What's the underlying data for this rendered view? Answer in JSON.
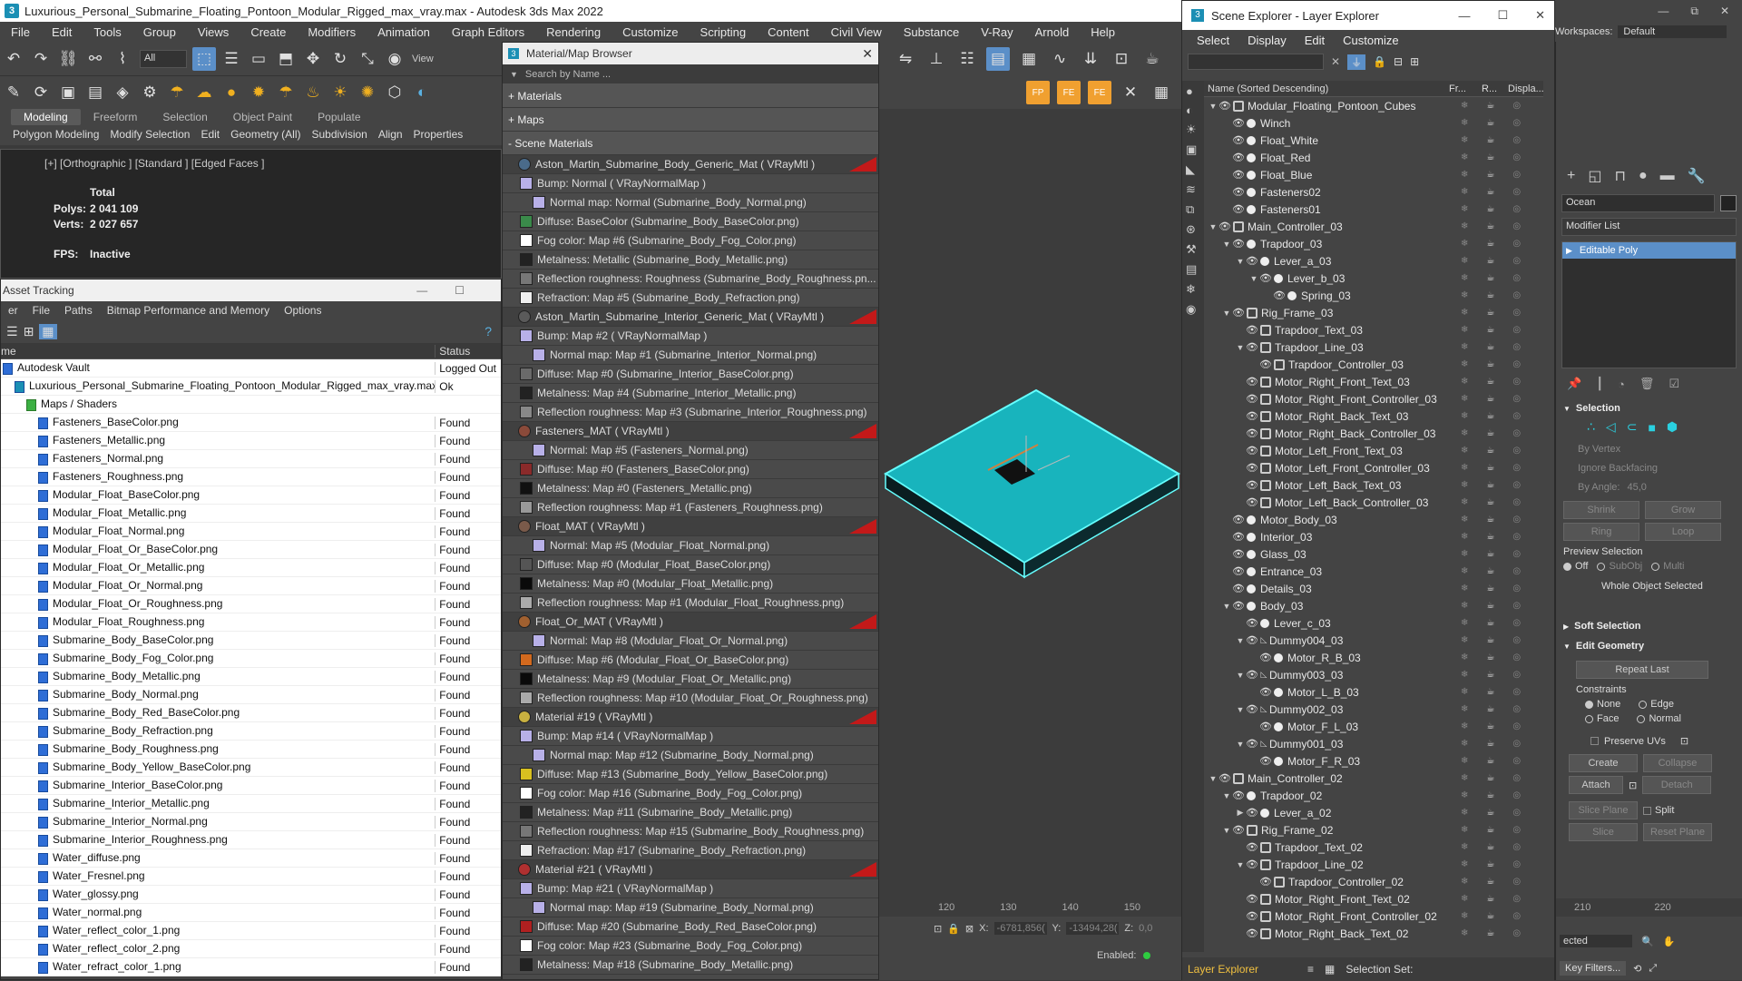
{
  "window": {
    "title": "Luxurious_Personal_Submarine_Floating_Pontoon_Modular_Rigged_max_vray.max - Autodesk 3ds Max 2022"
  },
  "menu": [
    "File",
    "Edit",
    "Tools",
    "Group",
    "Views",
    "Create",
    "Modifiers",
    "Animation",
    "Graph Editors",
    "Rendering",
    "Customize",
    "Scripting",
    "Content",
    "Civil View",
    "Substance",
    "V-Ray",
    "Arnold",
    "Help"
  ],
  "toolbar": {
    "selection_filter": "All",
    "view_label": "View"
  },
  "ribbon": {
    "tabs": [
      "Modeling",
      "Freeform",
      "Selection",
      "Object Paint",
      "Populate"
    ],
    "sub": [
      "Polygon Modeling",
      "Modify Selection",
      "Edit",
      "Geometry (All)",
      "Subdivision",
      "Align",
      "Properties"
    ]
  },
  "viewport": {
    "label": "[+] [Orthographic ] [Standard ] [Edged Faces ]",
    "total": "Total",
    "polys_label": "Polys:",
    "polys": "2 041 109",
    "verts_label": "Verts:",
    "verts": "2 027 657",
    "fps_label": "FPS:",
    "fps": "Inactive"
  },
  "asset": {
    "title": "Asset Tracking",
    "menu": [
      "er",
      "File",
      "Paths",
      "Bitmap Performance and Memory",
      "Options"
    ],
    "col_name": "me",
    "col_status": "Status",
    "rows": [
      {
        "n": "Autodesk Vault",
        "s": "Logged Out",
        "lvl": 0
      },
      {
        "n": "Luxurious_Personal_Submarine_Floating_Pontoon_Modular_Rigged_max_vray.max",
        "s": "Ok",
        "lvl": 1
      },
      {
        "n": "Maps / Shaders",
        "s": "",
        "lvl": 2
      },
      {
        "n": "Fasteners_BaseColor.png",
        "s": "Found",
        "lvl": 3
      },
      {
        "n": "Fasteners_Metallic.png",
        "s": "Found",
        "lvl": 3
      },
      {
        "n": "Fasteners_Normal.png",
        "s": "Found",
        "lvl": 3
      },
      {
        "n": "Fasteners_Roughness.png",
        "s": "Found",
        "lvl": 3
      },
      {
        "n": "Modular_Float_BaseColor.png",
        "s": "Found",
        "lvl": 3
      },
      {
        "n": "Modular_Float_Metallic.png",
        "s": "Found",
        "lvl": 3
      },
      {
        "n": "Modular_Float_Normal.png",
        "s": "Found",
        "lvl": 3
      },
      {
        "n": "Modular_Float_Or_BaseColor.png",
        "s": "Found",
        "lvl": 3
      },
      {
        "n": "Modular_Float_Or_Metallic.png",
        "s": "Found",
        "lvl": 3
      },
      {
        "n": "Modular_Float_Or_Normal.png",
        "s": "Found",
        "lvl": 3
      },
      {
        "n": "Modular_Float_Or_Roughness.png",
        "s": "Found",
        "lvl": 3
      },
      {
        "n": "Modular_Float_Roughness.png",
        "s": "Found",
        "lvl": 3
      },
      {
        "n": "Submarine_Body_BaseColor.png",
        "s": "Found",
        "lvl": 3
      },
      {
        "n": "Submarine_Body_Fog_Color.png",
        "s": "Found",
        "lvl": 3
      },
      {
        "n": "Submarine_Body_Metallic.png",
        "s": "Found",
        "lvl": 3
      },
      {
        "n": "Submarine_Body_Normal.png",
        "s": "Found",
        "lvl": 3
      },
      {
        "n": "Submarine_Body_Red_BaseColor.png",
        "s": "Found",
        "lvl": 3
      },
      {
        "n": "Submarine_Body_Refraction.png",
        "s": "Found",
        "lvl": 3
      },
      {
        "n": "Submarine_Body_Roughness.png",
        "s": "Found",
        "lvl": 3
      },
      {
        "n": "Submarine_Body_Yellow_BaseColor.png",
        "s": "Found",
        "lvl": 3
      },
      {
        "n": "Submarine_Interior_BaseColor.png",
        "s": "Found",
        "lvl": 3
      },
      {
        "n": "Submarine_Interior_Metallic.png",
        "s": "Found",
        "lvl": 3
      },
      {
        "n": "Submarine_Interior_Normal.png",
        "s": "Found",
        "lvl": 3
      },
      {
        "n": "Submarine_Interior_Roughness.png",
        "s": "Found",
        "lvl": 3
      },
      {
        "n": "Water_diffuse.png",
        "s": "Found",
        "lvl": 3
      },
      {
        "n": "Water_Fresnel.png",
        "s": "Found",
        "lvl": 3
      },
      {
        "n": "Water_glossy.png",
        "s": "Found",
        "lvl": 3
      },
      {
        "n": "Water_normal.png",
        "s": "Found",
        "lvl": 3
      },
      {
        "n": "Water_reflect_color_1.png",
        "s": "Found",
        "lvl": 3
      },
      {
        "n": "Water_reflect_color_2.png",
        "s": "Found",
        "lvl": 3
      },
      {
        "n": "Water_refract_color_1.png",
        "s": "Found",
        "lvl": 3
      }
    ]
  },
  "matbrowser": {
    "title": "Material/Map Browser",
    "search": "Search by Name ...",
    "sections": [
      "+ Materials",
      "+ Maps",
      "- Scene Materials"
    ],
    "rows": [
      {
        "t": "Aston_Martin_Submarine_Body_Generic_Mat  ( VRayMtl )",
        "m": 1,
        "c": "#4a6b8a"
      },
      {
        "t": "Bump: Normal  ( VRayNormalMap )",
        "i": 1,
        "c": "#b8b0e8"
      },
      {
        "t": "Normal map: Normal (Submarine_Body_Normal.png)",
        "i": 2,
        "c": "#b8b0e8"
      },
      {
        "t": "Diffuse: BaseColor (Submarine_Body_BaseColor.png)",
        "i": 1,
        "c": "#3a8a4a"
      },
      {
        "t": "Fog color: Map #6 (Submarine_Body_Fog_Color.png)",
        "i": 1,
        "c": "#ffffff"
      },
      {
        "t": "Metalness: Metallic (Submarine_Body_Metallic.png)",
        "i": 1,
        "c": "#222222"
      },
      {
        "t": "Reflection roughness: Roughness (Submarine_Body_Roughness.pn...",
        "i": 1,
        "c": "#777777"
      },
      {
        "t": "Refraction: Map #5 (Submarine_Body_Refraction.png)",
        "i": 1,
        "c": "#eeeeee"
      },
      {
        "t": "Aston_Martin_Submarine_Interior_Generic_Mat  ( VRayMtl )",
        "m": 1,
        "c": "#5a5a5a"
      },
      {
        "t": "Bump: Map #2  ( VRayNormalMap )",
        "i": 1,
        "c": "#b8b0e8"
      },
      {
        "t": "Normal map: Map #1 (Submarine_Interior_Normal.png)",
        "i": 2,
        "c": "#b8b0e8"
      },
      {
        "t": "Diffuse: Map #0 (Submarine_Interior_BaseColor.png)",
        "i": 1,
        "c": "#6a6a6a"
      },
      {
        "t": "Metalness: Map #4 (Submarine_Interior_Metallic.png)",
        "i": 1,
        "c": "#222222"
      },
      {
        "t": "Reflection roughness: Map #3 (Submarine_Interior_Roughness.png)",
        "i": 1,
        "c": "#888888"
      },
      {
        "t": "Fasteners_MAT  ( VRayMtl )",
        "m": 1,
        "c": "#8a4a3a"
      },
      {
        "t": "Normal: Map #5 (Fasteners_Normal.png)",
        "i": 2,
        "c": "#b8b0e8"
      },
      {
        "t": "Diffuse: Map #0 (Fasteners_BaseColor.png)",
        "i": 1,
        "c": "#8a2a2a"
      },
      {
        "t": "Metalness: Map #0 (Fasteners_Metallic.png)",
        "i": 1,
        "c": "#111111"
      },
      {
        "t": "Reflection roughness: Map #1 (Fasteners_Roughness.png)",
        "i": 1,
        "c": "#999999"
      },
      {
        "t": "Float_MAT  ( VRayMtl )",
        "m": 1,
        "c": "#7a5a4a"
      },
      {
        "t": "Normal: Map #5 (Modular_Float_Normal.png)",
        "i": 2,
        "c": "#b8b0e8"
      },
      {
        "t": "Diffuse: Map #0 (Modular_Float_BaseColor.png)",
        "i": 1,
        "c": "#555555"
      },
      {
        "t": "Metalness: Map #0 (Modular_Float_Metallic.png)",
        "i": 1,
        "c": "#0a0a0a"
      },
      {
        "t": "Reflection roughness: Map #1 (Modular_Float_Roughness.png)",
        "i": 1,
        "c": "#aaaaaa"
      },
      {
        "t": "Float_Or_MAT  ( VRayMtl )",
        "m": 1,
        "c": "#a06030"
      },
      {
        "t": "Normal: Map #8 (Modular_Float_Or_Normal.png)",
        "i": 2,
        "c": "#b8b0e8"
      },
      {
        "t": "Diffuse: Map #6 (Modular_Float_Or_BaseColor.png)",
        "i": 1,
        "c": "#d2691e"
      },
      {
        "t": "Metalness: Map #9 (Modular_Float_Or_Metallic.png)",
        "i": 1,
        "c": "#0a0a0a"
      },
      {
        "t": "Reflection roughness: Map #10 (Modular_Float_Or_Roughness.png)",
        "i": 1,
        "c": "#aaaaaa"
      },
      {
        "t": "Material #19  ( VRayMtl )",
        "m": 1,
        "c": "#c8b040"
      },
      {
        "t": "Bump: Map #14  ( VRayNormalMap )",
        "i": 1,
        "c": "#b8b0e8"
      },
      {
        "t": "Normal map: Map #12 (Submarine_Body_Normal.png)",
        "i": 2,
        "c": "#b8b0e8"
      },
      {
        "t": "Diffuse: Map #13 (Submarine_Body_Yellow_BaseColor.png)",
        "i": 1,
        "c": "#d8c020"
      },
      {
        "t": "Fog color: Map #16 (Submarine_Body_Fog_Color.png)",
        "i": 1,
        "c": "#ffffff"
      },
      {
        "t": "Metalness: Map #11 (Submarine_Body_Metallic.png)",
        "i": 1,
        "c": "#222222"
      },
      {
        "t": "Reflection roughness: Map #15 (Submarine_Body_Roughness.png)",
        "i": 1,
        "c": "#777777"
      },
      {
        "t": "Refraction: Map #17 (Submarine_Body_Refraction.png)",
        "i": 1,
        "c": "#eeeeee"
      },
      {
        "t": "Material #21  ( VRayMtl )",
        "m": 1,
        "c": "#b03030"
      },
      {
        "t": "Bump: Map #21  ( VRayNormalMap )",
        "i": 1,
        "c": "#b8b0e8"
      },
      {
        "t": "Normal map: Map #19 (Submarine_Body_Normal.png)",
        "i": 2,
        "c": "#b8b0e8"
      },
      {
        "t": "Diffuse: Map #20 (Submarine_Body_Red_BaseColor.png)",
        "i": 1,
        "c": "#b02020"
      },
      {
        "t": "Fog color: Map #23 (Submarine_Body_Fog_Color.png)",
        "i": 1,
        "c": "#ffffff"
      },
      {
        "t": "Metalness: Map #18 (Submarine_Body_Metallic.png)",
        "i": 1,
        "c": "#222222"
      }
    ]
  },
  "scene_explorer": {
    "title": "Scene Explorer - Layer Explorer",
    "menu": [
      "Select",
      "Display",
      "Edit",
      "Customize"
    ],
    "col_name": "Name (Sorted Descending)",
    "col_fr": "Fr...",
    "col_r": "R...",
    "col_disp": "Displa...",
    "rows": [
      {
        "n": "Modular_Floating_Pontoon_Cubes",
        "l": 0,
        "e": "v",
        "k": "g"
      },
      {
        "n": "Winch",
        "l": 1,
        "k": "d"
      },
      {
        "n": "Float_White",
        "l": 1,
        "k": "d"
      },
      {
        "n": "Float_Red",
        "l": 1,
        "k": "d"
      },
      {
        "n": "Float_Blue",
        "l": 1,
        "k": "d"
      },
      {
        "n": "Fasteners02",
        "l": 1,
        "k": "d"
      },
      {
        "n": "Fasteners01",
        "l": 1,
        "k": "d"
      },
      {
        "n": "Main_Controller_03",
        "l": 0,
        "e": "v",
        "k": "g"
      },
      {
        "n": "Trapdoor_03",
        "l": 1,
        "e": "v",
        "k": "d"
      },
      {
        "n": "Lever_a_03",
        "l": 2,
        "e": "v",
        "k": "d"
      },
      {
        "n": "Lever_b_03",
        "l": 3,
        "e": "v",
        "k": "d"
      },
      {
        "n": "Spring_03",
        "l": 4,
        "k": "d"
      },
      {
        "n": "Rig_Frame_03",
        "l": 1,
        "e": "v",
        "k": "g"
      },
      {
        "n": "Trapdoor_Text_03",
        "l": 2,
        "k": "g"
      },
      {
        "n": "Trapdoor_Line_03",
        "l": 2,
        "e": "v",
        "k": "g"
      },
      {
        "n": "Trapdoor_Controller_03",
        "l": 3,
        "k": "g"
      },
      {
        "n": "Motor_Right_Front_Text_03",
        "l": 2,
        "k": "g"
      },
      {
        "n": "Motor_Right_Front_Controller_03",
        "l": 2,
        "k": "g"
      },
      {
        "n": "Motor_Right_Back_Text_03",
        "l": 2,
        "k": "g"
      },
      {
        "n": "Motor_Right_Back_Controller_03",
        "l": 2,
        "k": "g"
      },
      {
        "n": "Motor_Left_Front_Text_03",
        "l": 2,
        "k": "g"
      },
      {
        "n": "Motor_Left_Front_Controller_03",
        "l": 2,
        "k": "g"
      },
      {
        "n": "Motor_Left_Back_Text_03",
        "l": 2,
        "k": "g"
      },
      {
        "n": "Motor_Left_Back_Controller_03",
        "l": 2,
        "k": "g"
      },
      {
        "n": "Motor_Body_03",
        "l": 1,
        "k": "d"
      },
      {
        "n": "Interior_03",
        "l": 1,
        "k": "d"
      },
      {
        "n": "Glass_03",
        "l": 1,
        "k": "d"
      },
      {
        "n": "Entrance_03",
        "l": 1,
        "k": "d"
      },
      {
        "n": "Details_03",
        "l": 1,
        "k": "d"
      },
      {
        "n": "Body_03",
        "l": 1,
        "e": "v",
        "k": "d"
      },
      {
        "n": "Lever_c_03",
        "l": 2,
        "k": "d"
      },
      {
        "n": "Dummy004_03",
        "l": 2,
        "e": "v",
        "k": "t"
      },
      {
        "n": "Motor_R_B_03",
        "l": 3,
        "k": "d"
      },
      {
        "n": "Dummy003_03",
        "l": 2,
        "e": "v",
        "k": "t"
      },
      {
        "n": "Motor_L_B_03",
        "l": 3,
        "k": "d"
      },
      {
        "n": "Dummy002_03",
        "l": 2,
        "e": "v",
        "k": "t"
      },
      {
        "n": "Motor_F_L_03",
        "l": 3,
        "k": "d"
      },
      {
        "n": "Dummy001_03",
        "l": 2,
        "e": "v",
        "k": "t"
      },
      {
        "n": "Motor_F_R_03",
        "l": 3,
        "k": "d"
      },
      {
        "n": "Main_Controller_02",
        "l": 0,
        "e": "v",
        "k": "g"
      },
      {
        "n": "Trapdoor_02",
        "l": 1,
        "e": "v",
        "k": "d"
      },
      {
        "n": "Lever_a_02",
        "l": 2,
        "e": ">",
        "k": "d"
      },
      {
        "n": "Rig_Frame_02",
        "l": 1,
        "e": "v",
        "k": "g"
      },
      {
        "n": "Trapdoor_Text_02",
        "l": 2,
        "k": "g"
      },
      {
        "n": "Trapdoor_Line_02",
        "l": 2,
        "e": "v",
        "k": "g"
      },
      {
        "n": "Trapdoor_Controller_02",
        "l": 3,
        "k": "g"
      },
      {
        "n": "Motor_Right_Front_Text_02",
        "l": 2,
        "k": "g"
      },
      {
        "n": "Motor_Right_Front_Controller_02",
        "l": 2,
        "k": "g"
      },
      {
        "n": "Motor_Right_Back_Text_02",
        "l": 2,
        "k": "g"
      }
    ],
    "footer_layer": "Layer Explorer",
    "footer_selset": "Selection Set:"
  },
  "command_panel": {
    "workspaces_label": "Workspaces:",
    "workspace": "Default",
    "object_name": "Ocean",
    "modifier_list": "Modifier List",
    "modifier": "Editable Poly",
    "selection": "Selection",
    "by_vertex": "By Vertex",
    "ignore_backfacing": "Ignore Backfacing",
    "by_angle": "By Angle:",
    "angle": "45,0",
    "shrink": "Shrink",
    "grow": "Grow",
    "ring": "Ring",
    "loop": "Loop",
    "preview_selection": "Preview Selection",
    "off": "Off",
    "subobj": "SubObj",
    "multi": "Multi",
    "whole": "Whole Object Selected",
    "soft_selection": "Soft Selection",
    "edit_geometry": "Edit Geometry",
    "repeat_last": "Repeat Last",
    "constraints": "Constraints",
    "none": "None",
    "edge": "Edge",
    "face": "Face",
    "normal": "Normal",
    "preserve_uvs": "Preserve UVs",
    "create": "Create",
    "collapse": "Collapse",
    "attach": "Attach",
    "detach": "Detach",
    "slice_plane": "Slice Plane",
    "split": "Split",
    "slice": "Slice",
    "reset_plane": "Reset Plane",
    "ruler_right": [
      "210",
      "220"
    ],
    "key_filters": "Key Filters...",
    "selected": "ected"
  },
  "timeline": {
    "ticks": [
      "120",
      "130",
      "140",
      "150"
    ],
    "x_label": "X:",
    "x_val": "-6781,856(",
    "y_label": "Y:",
    "y_val": "-13494,28(",
    "z_label": "Z:",
    "z_val": "0,0",
    "enabled": "Enabled:"
  }
}
